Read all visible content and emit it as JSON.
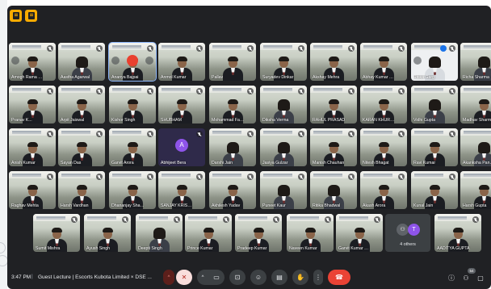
{
  "meeting": {
    "time": "3:47 PM",
    "divider": "|",
    "title": "Guest Lecture | Escorts Kubota Limited × DSE ..."
  },
  "participants": [
    {
      "name": "Amogh Rama Ka..."
    },
    {
      "name": "Aastha Agarwal"
    },
    {
      "name": "Ananya Bajpai"
    },
    {
      "name": "Anmol Kumar"
    },
    {
      "name": "Pallav"
    },
    {
      "name": "Suryadev Dinkar"
    },
    {
      "name": "Akshay Mehra"
    },
    {
      "name": "Abhay Kumar Mis..."
    },
    {
      "name": "Ritika Garg"
    },
    {
      "name": "Richa Sharma"
    },
    {
      "name": "Pranav K..."
    },
    {
      "name": "Arpit Jaiswal"
    },
    {
      "name": "Kishor Singh"
    },
    {
      "name": "SHUBHAM"
    },
    {
      "name": "Mohammad Fahi..."
    },
    {
      "name": "Diksha Verma"
    },
    {
      "name": "RAHUL PRASAD"
    },
    {
      "name": "KARAN KHURANA"
    },
    {
      "name": "Vidhi Gupta"
    },
    {
      "name": "Madhav Sharma"
    },
    {
      "name": "Anish Kumar"
    },
    {
      "name": "Sayan Das"
    },
    {
      "name": "Garvit Arora"
    },
    {
      "name": "Abhijeet Bera",
      "initial": "A"
    },
    {
      "name": "Darshi Jain"
    },
    {
      "name": "Jasiya Gulzar"
    },
    {
      "name": "Manish Chauhan"
    },
    {
      "name": "Nitesh Bhagat"
    },
    {
      "name": "Ravi Kumar"
    },
    {
      "name": "Akanksha Pandey"
    },
    {
      "name": "Raghav Mehta"
    },
    {
      "name": "Harsh Vardhan"
    },
    {
      "name": "Dhananjay Sharma"
    },
    {
      "name": "SANJAY KRISH..."
    },
    {
      "name": "Akhilesh Yadav"
    },
    {
      "name": "Puneet Kaur"
    },
    {
      "name": "Ritika Bhadwal"
    },
    {
      "name": "Akash Arora"
    },
    {
      "name": "Kunal Jain"
    },
    {
      "name": "Harsh Gupta"
    },
    {
      "name": "Sumit Mishra"
    },
    {
      "name": "Ayush Singh"
    },
    {
      "name": "Deepti Singh"
    },
    {
      "name": "Prince Kumar"
    },
    {
      "name": "Pradeep Kumar"
    },
    {
      "name": "Naveen Kumar"
    },
    {
      "name": "Garvit Kumar Ga..."
    },
    {
      "name": "AADITYA GUPTA"
    }
  ],
  "others_tile": {
    "label": "4 others",
    "initial": "T"
  },
  "people_count": "54",
  "icons": [
    "folder-icon",
    "notes-icon",
    "mic-off-icon",
    "camera-icon",
    "present-icon",
    "emoji-icon",
    "captions-icon",
    "raise-hand-icon",
    "more-icon",
    "end-call-icon",
    "info-icon",
    "people-icon",
    "chat-icon"
  ],
  "colors": {
    "accent_yellow": "#f9ab00",
    "end_call": "#ea4335",
    "background": "#202124",
    "avatar_purple": "#8e54e9",
    "avatar_blue": "#4285f4"
  }
}
